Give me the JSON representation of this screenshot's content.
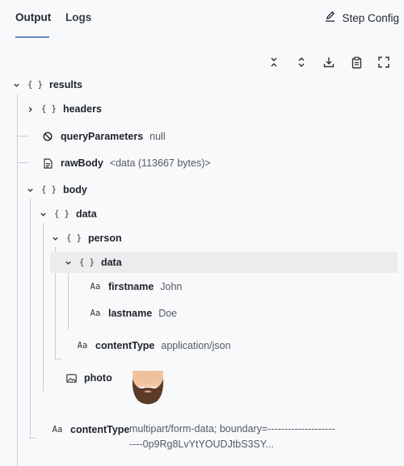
{
  "tabs": {
    "output": "Output",
    "logs": "Logs"
  },
  "step_config": "Step Config",
  "toolbar": [
    "collapse-all-icon",
    "expand-all-icon",
    "download-icon",
    "clipboard-icon",
    "fullscreen-icon"
  ],
  "tree": {
    "results": {
      "key": "results",
      "icon": "{ }"
    },
    "headers": {
      "key": "headers",
      "icon": "{ }"
    },
    "queryParameters": {
      "key": "queryParameters",
      "value": "null"
    },
    "rawBody": {
      "key": "rawBody",
      "value": "<data (113667 bytes)>"
    },
    "body": {
      "key": "body",
      "icon": "{ }"
    },
    "data": {
      "key": "data",
      "icon": "{ }"
    },
    "person": {
      "key": "person",
      "icon": "{ }"
    },
    "person_data": {
      "key": "data",
      "icon": "{ }"
    },
    "firstname": {
      "key": "firstname",
      "icon": "Aa",
      "value": "John"
    },
    "lastname": {
      "key": "lastname",
      "icon": "Aa",
      "value": "Doe"
    },
    "inner_contentType": {
      "key": "contentType",
      "icon": "Aa",
      "value": "application/json"
    },
    "photo": {
      "key": "photo"
    },
    "outer_contentType": {
      "key": "contentType",
      "icon": "Aa",
      "value_line1": "multipart/form-data; boundary=--------------------",
      "value_line2": "----0p9Rg8LvYtYOUDJtbS3SY..."
    }
  },
  "colors": {
    "accent": "#6b86c7",
    "background": "#f8f9fb",
    "highlight": "#ececee"
  }
}
